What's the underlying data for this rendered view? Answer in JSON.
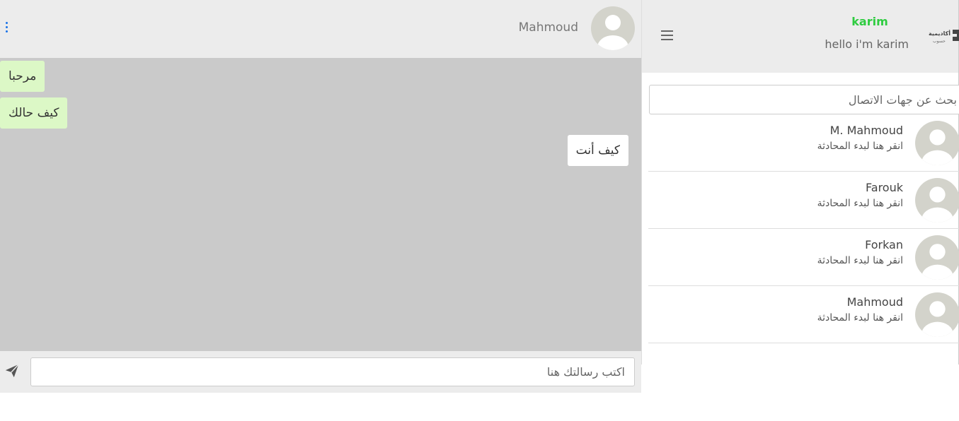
{
  "chat": {
    "contact_name": "Mahmoud",
    "messages": [
      {
        "text": "مرحبا",
        "direction": "incoming"
      },
      {
        "text": "كيف حالك",
        "direction": "incoming"
      },
      {
        "text": "كيف أنت",
        "direction": "outgoing"
      }
    ],
    "composer": {
      "placeholder": "اكتب رسالتك هنا"
    }
  },
  "sidebar": {
    "user": {
      "name": "karim",
      "status": "hello i'm karim"
    },
    "brand": {
      "line1": "أكاديمية",
      "line2": "حسوب"
    },
    "search": {
      "placeholder": "بحث عن جهات الاتصال"
    },
    "contacts": [
      {
        "name": "M. Mahmoud",
        "hint": "انقر هنا لبدء المحادثة"
      },
      {
        "name": "Farouk",
        "hint": "انقر هنا لبدء المحادثة"
      },
      {
        "name": "Forkan",
        "hint": "انقر هنا لبدء المحادثة"
      },
      {
        "name": "Mahmoud",
        "hint": "انقر هنا لبدء المحادثة"
      }
    ]
  },
  "colors": {
    "incoming_bubble": "#dcf8c6",
    "outgoing_bubble": "#ffffff",
    "username": "#2ecc40",
    "kebab": "#1a73e8",
    "chat_background": "#cacaca",
    "header_background": "#ececec"
  },
  "icons": {
    "chat_menu": "kebab-vertical-icon",
    "send": "paper-plane-icon",
    "side_menu": "hamburger-icon",
    "avatar": "default-user-avatar-icon"
  }
}
